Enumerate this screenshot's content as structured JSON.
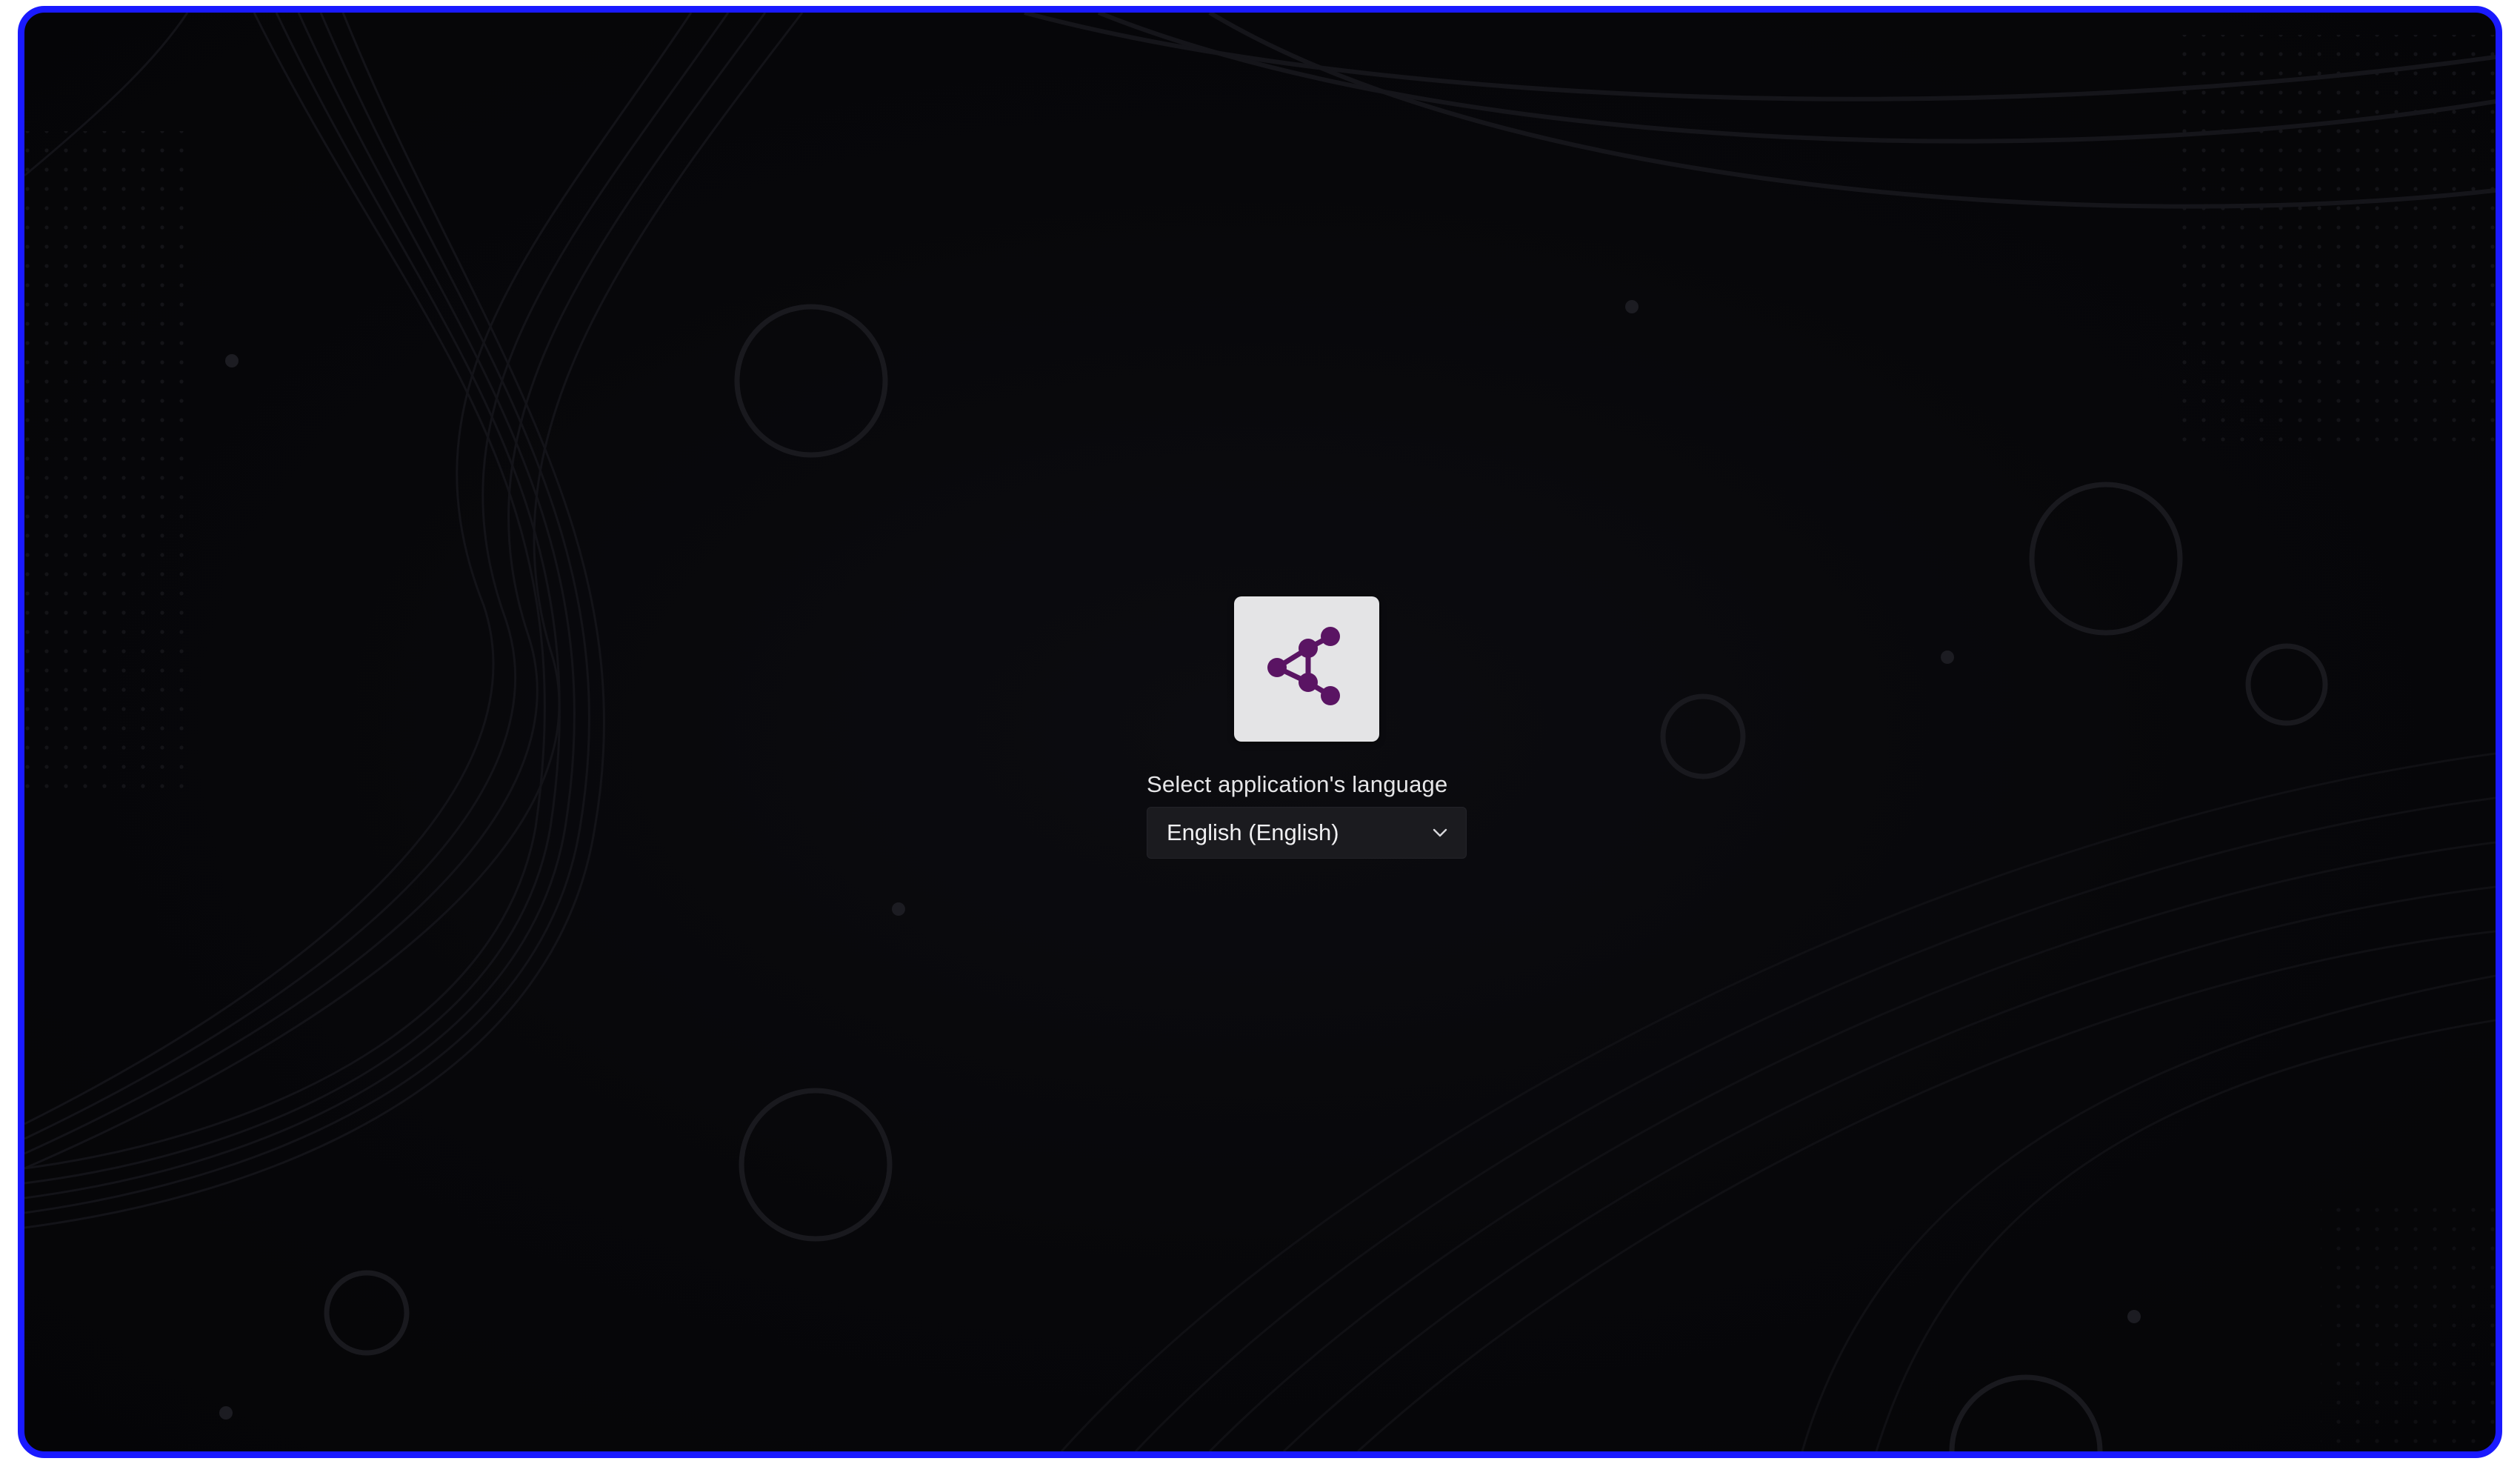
{
  "app": {
    "logo_icon": "share-network-icon",
    "accent_color": "#5a1463",
    "frame_border_color": "#1a1aff",
    "background_color": "#07070a"
  },
  "language_picker": {
    "label": "Select application's language",
    "selected_value": "English (English)",
    "chevron_icon": "chevron-down-icon"
  }
}
